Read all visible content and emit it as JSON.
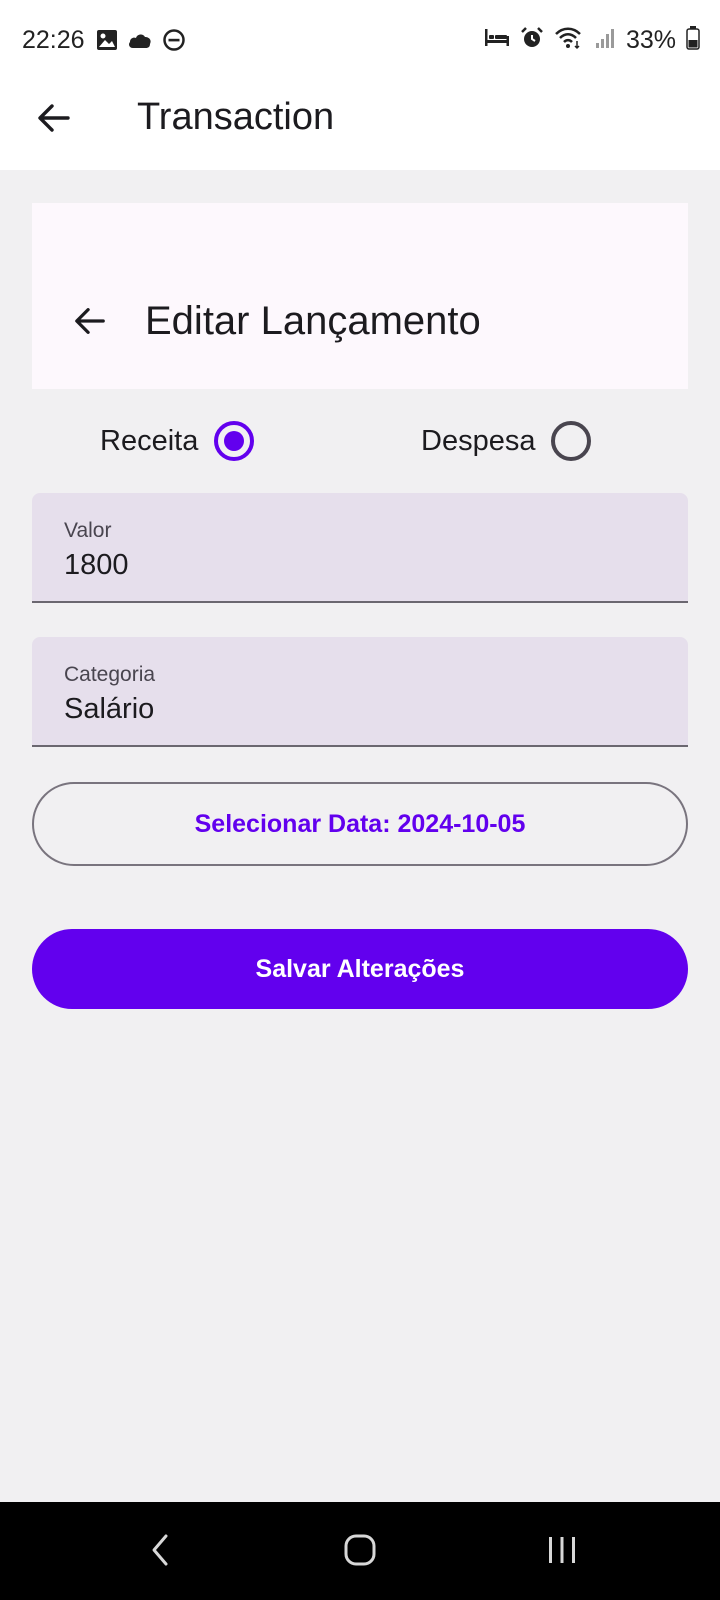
{
  "status_bar": {
    "time": "22:26",
    "battery": "33%",
    "left_icons": [
      "gallery-icon",
      "cloud-icon",
      "do-not-disturb-icon"
    ],
    "right_icons": [
      "sleep-icon",
      "alarm-icon",
      "wifi-icon",
      "signal-icon",
      "battery-icon"
    ]
  },
  "app_bar": {
    "title": "Transaction",
    "back_icon": "arrow-back-icon"
  },
  "form_header": {
    "title": "Editar Lançamento",
    "back_icon": "arrow-back-icon"
  },
  "type_selector": {
    "options": [
      {
        "label": "Receita",
        "selected": true
      },
      {
        "label": "Despesa",
        "selected": false
      }
    ]
  },
  "fields": {
    "valor": {
      "label": "Valor",
      "value": "1800"
    },
    "categoria": {
      "label": "Categoria",
      "value": "Salário"
    }
  },
  "date_button": {
    "label": "Selecionar Data: 2024-10-05"
  },
  "save_button": {
    "label": "Salvar Alterações"
  },
  "nav_bar": {
    "buttons": [
      "recent-apps-icon",
      "home-icon",
      "back-icon"
    ]
  },
  "colors": {
    "accent": "#6200ee",
    "field_background": "#e6dfec",
    "page_background": "#f1f0f2",
    "header_card_background": "#fdf8fd"
  }
}
